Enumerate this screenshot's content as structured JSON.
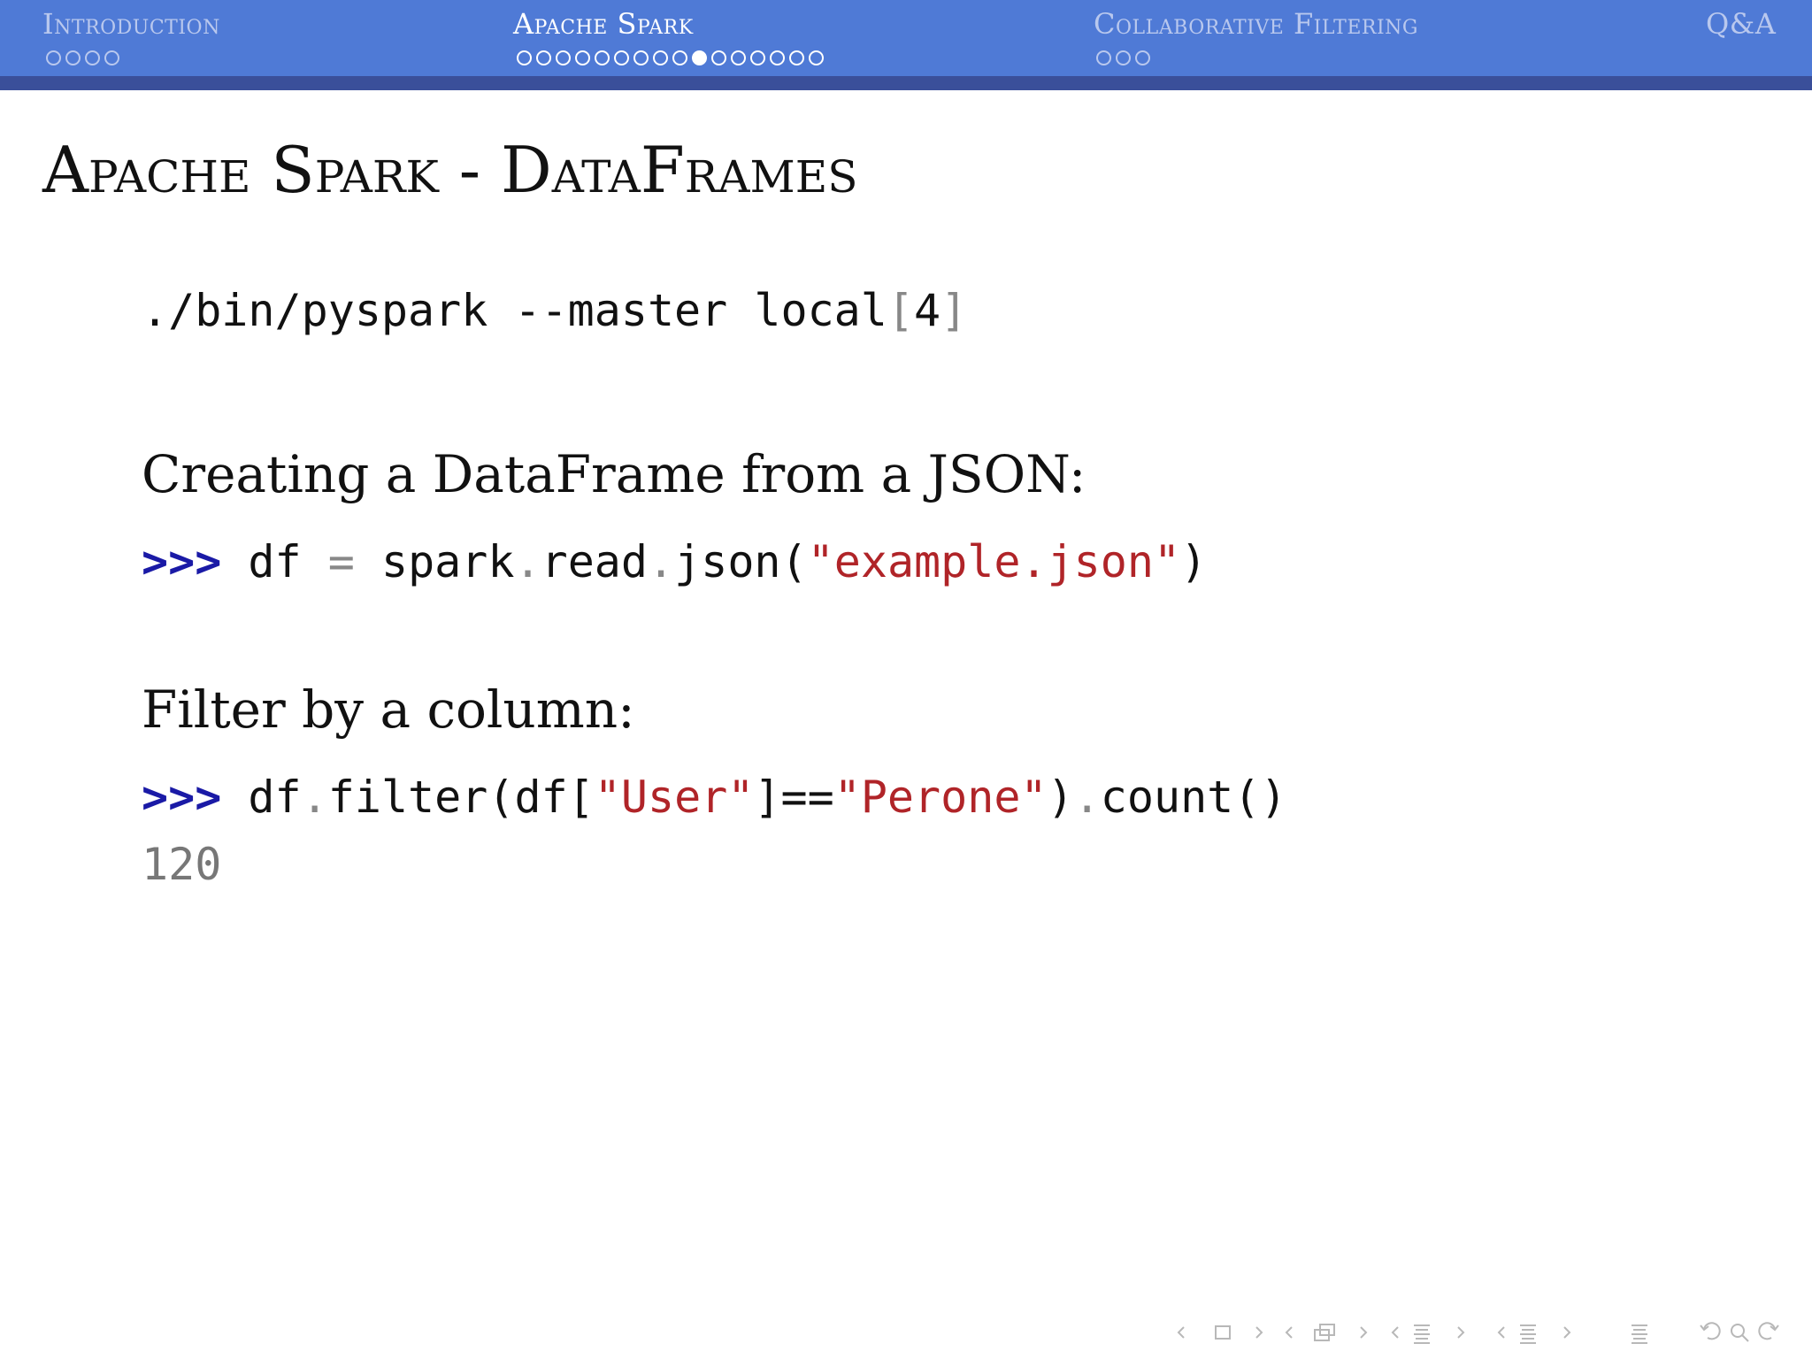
{
  "header": {
    "sections": [
      {
        "label": "Introduction",
        "dots": 4,
        "filled_index": -1,
        "active": false
      },
      {
        "label": "Apache Spark",
        "dots": 16,
        "filled_index": 9,
        "active": true
      },
      {
        "label": "Collaborative Filtering",
        "dots": 3,
        "filled_index": -1,
        "active": false
      },
      {
        "label": "Q&A",
        "dots": 0,
        "filled_index": -1,
        "active": false
      }
    ]
  },
  "slide": {
    "title": "Apache Spark - DataFrames",
    "command": {
      "text": "./bin/pyspark --master local",
      "bracket_open": "[",
      "arg": "4",
      "bracket_close": "]"
    },
    "section1": {
      "heading": "Creating a DataFrame from a JSON:",
      "prompt": ">>>",
      "code_a": "df",
      "code_eq": "=",
      "code_b": "spark",
      "dot1": ".",
      "code_c": "read",
      "dot2": ".",
      "code_d": "json(",
      "string": "\"example.json\"",
      "code_e": ")"
    },
    "section2": {
      "heading": "Filter by a column:",
      "prompt": ">>>",
      "code_a": "df",
      "dot1": ".",
      "code_b": "filter(df[",
      "string1": "\"User\"",
      "code_c": "]==",
      "string2": "\"Perone\"",
      "code_d": ")",
      "dot2": ".",
      "code_e": "count()",
      "output": "120"
    }
  },
  "nav_icons": [
    "nav-prev-slide-icon",
    "nav-slide-icon",
    "nav-next-slide-icon",
    "nav-prev-frame-icon",
    "nav-frame-icon",
    "nav-next-frame-icon",
    "nav-prev-subsection-icon",
    "nav-subsection-icon",
    "nav-next-subsection-icon",
    "nav-prev-section-icon",
    "nav-section-icon",
    "nav-next-section-icon",
    "nav-document-icon",
    "nav-back-icon",
    "nav-search-icon",
    "nav-forward-icon"
  ],
  "colors": {
    "header": "#4f7ad6",
    "header_bar": "#3a4f9a",
    "prompt": "#1a1aa6",
    "string": "#b02428"
  }
}
